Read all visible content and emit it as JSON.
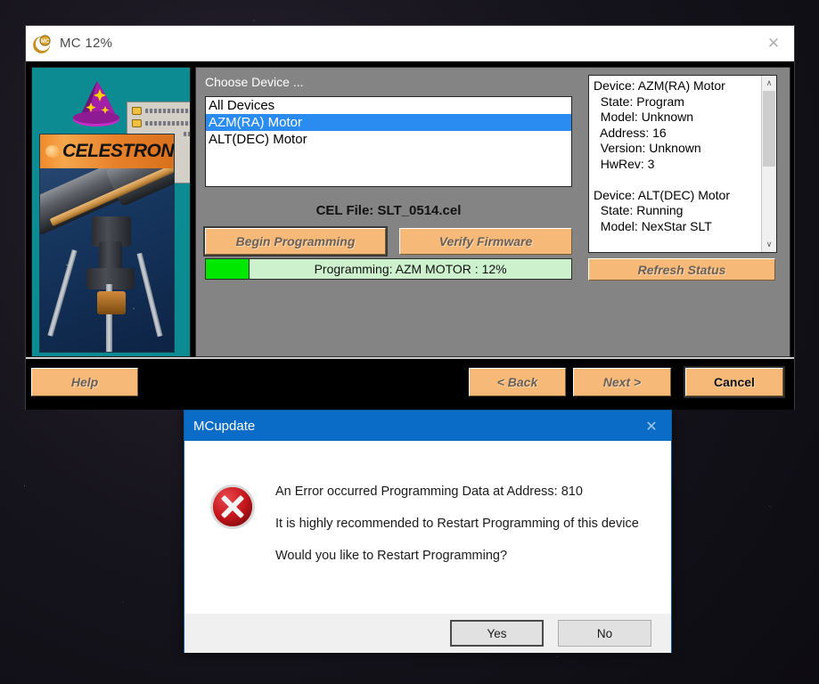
{
  "desktop": {
    "background_name": "starfield-wallpaper"
  },
  "mc_window": {
    "title": "MC 12%",
    "app_icon": "mc-crescent-icon",
    "close_label": "✕",
    "illustration": {
      "panel_color": "#0d8b92",
      "wizard_icon": "wizard-hat-icon",
      "brand_text": "CELESTRON",
      "file_items": [
        "folder-item-1",
        "folder-item-2"
      ]
    },
    "choose_device": {
      "label": "Choose Device ...",
      "items": [
        {
          "label": "All Devices",
          "selected": false
        },
        {
          "label": "AZM(RA) Motor",
          "selected": true
        },
        {
          "label": "ALT(DEC) Motor",
          "selected": false
        }
      ]
    },
    "cel_file_line": "CEL File: SLT_0514.cel",
    "buttons": {
      "begin_programming": "Begin Programming",
      "verify_firmware": "Verify Firmware",
      "refresh_status": "Refresh Status",
      "help": "Help",
      "back": "< Back",
      "next": "Next >",
      "cancel": "Cancel"
    },
    "progress": {
      "percent": 12,
      "text": "Programming: AZM MOTOR : 12%",
      "fill_color": "#00e800",
      "track_color": "#cdf0cd"
    },
    "status_panel": {
      "text": "Device: AZM(RA) Motor\n  State: Program\n  Model: Unknown\n  Address: 16\n  Version: Unknown\n  HwRev: 3\n\nDevice: ALT(DEC) Motor\n  State: Running\n  Model: NexStar SLT",
      "scroll_up": "∧",
      "scroll_down": "∨"
    }
  },
  "mcupdate_dialog": {
    "title": "MCupdate",
    "close_label": "✕",
    "icon": "error-circle-x-icon",
    "messages": [
      "An Error occurred Programming Data at Address: 810",
      "It is highly recommended to Restart Programming of this device",
      "Would you like to Restart Programming?"
    ],
    "buttons": {
      "yes": "Yes",
      "no": "No"
    },
    "accent_color": "#0a6cc6",
    "error_color": "#c4161c"
  }
}
